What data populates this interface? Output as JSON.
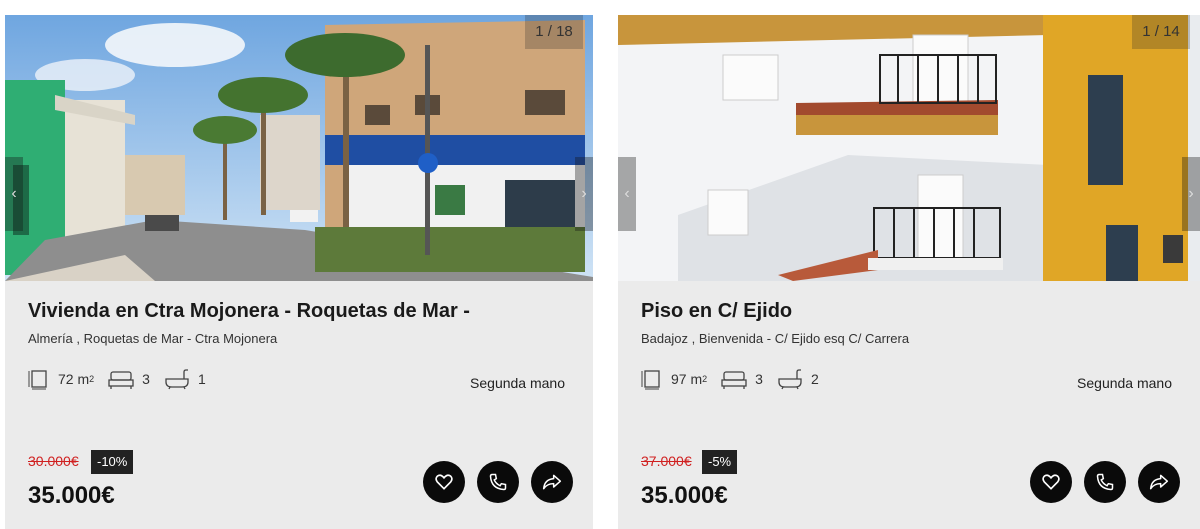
{
  "listings": [
    {
      "photo_counter": "1 / 18",
      "title": "Vivienda en Ctra Mojonera - Roquetas de Mar -",
      "location": "Almería , Roquetas de Mar - Ctra Mojonera",
      "area": "72",
      "area_unit": "m",
      "area_sup": "2",
      "bedrooms": "3",
      "bathrooms": "1",
      "condition": "Segunda mano",
      "old_price": "30.000€",
      "discount": "-10%",
      "price": "35.000€"
    },
    {
      "photo_counter": "1 / 14",
      "title": "Piso en C/ Ejido",
      "location": "Badajoz , Bienvenida - C/ Ejido esq C/ Carrera",
      "area": "97",
      "area_unit": "m",
      "area_sup": "2",
      "bedrooms": "3",
      "bathrooms": "2",
      "condition": "Segunda mano",
      "old_price": "37.000€",
      "discount": "-5%",
      "price": "35.000€"
    }
  ],
  "icons": {
    "area": "floor-plan-icon",
    "bedrooms": "bed-icon",
    "bathrooms": "bathtub-icon",
    "favorite": "heart-icon",
    "call": "phone-icon",
    "share": "share-arrow-icon",
    "prev": "chevron-left-icon",
    "next": "chevron-right-icon"
  },
  "colors": {
    "card_bg": "#ebebeb",
    "old_price": "#d02020",
    "discount_bg": "#222222",
    "action_bg": "#0a0a0a"
  }
}
